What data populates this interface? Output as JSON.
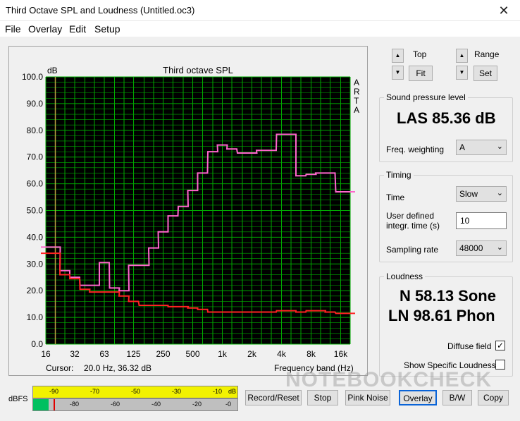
{
  "window": {
    "title": "Third Octave SPL and Loudness (Untitled.oc3)",
    "close_glyph": "✕"
  },
  "menu": {
    "file": "File",
    "overlay": "Overlay",
    "edit": "Edit",
    "setup": "Setup"
  },
  "plot": {
    "unit_label": "dB",
    "xlabel": "Frequency band (Hz)",
    "cursor_label": "Cursor:",
    "cursor_value": "20.0 Hz, 36.32 dB",
    "side_text": [
      "A",
      "R",
      "T",
      "A"
    ]
  },
  "chart_data": {
    "type": "line",
    "title": "Third octave SPL",
    "ylabel": "dB",
    "ylim": [
      0,
      100
    ],
    "y_ticks": [
      "0.0",
      "10.0",
      "20.0",
      "30.0",
      "40.0",
      "50.0",
      "60.0",
      "70.0",
      "80.0",
      "90.0",
      "100.0"
    ],
    "x_scale": "log",
    "x_ticks": [
      "16",
      "32",
      "63",
      "125",
      "250",
      "500",
      "1k",
      "2k",
      "4k",
      "8k",
      "16k"
    ],
    "grid": true,
    "colors": {
      "background": "#000000",
      "grid": "#00aa00",
      "pink": "#ff66cc",
      "red": "#ff2222",
      "cursor": "#b8a040"
    },
    "cursor_x": 20,
    "bands": [
      16,
      20,
      25,
      31.5,
      40,
      50,
      63,
      80,
      100,
      125,
      160,
      200,
      250,
      315,
      400,
      500,
      630,
      800,
      1000,
      1250,
      1600,
      2000,
      2500,
      3150,
      4000,
      5000,
      6300,
      8000,
      10000,
      12500,
      16000,
      20000
    ],
    "series": [
      {
        "values": [
          36.3,
          36.3,
          27.5,
          25,
          22,
          22,
          30.5,
          21,
          20,
          29.5,
          29.5,
          36,
          42,
          48,
          51.5,
          57.5,
          64,
          72,
          74.5,
          73,
          71.5,
          71.5,
          72.5,
          72.5,
          78.5,
          78.5,
          63,
          63.5,
          64,
          64,
          57,
          57
        ]
      },
      {
        "values": [
          34,
          34,
          26,
          24.5,
          20.5,
          19.5,
          19.5,
          19.5,
          18,
          16,
          14.5,
          14.5,
          14.5,
          14,
          14,
          13.5,
          13,
          12,
          12,
          12,
          12,
          12,
          12,
          12,
          12.5,
          12.5,
          12,
          12.5,
          12.5,
          12,
          11.5,
          11.5
        ]
      }
    ]
  },
  "controls": {
    "top_label": "Top",
    "range_label": "Range",
    "fit_label": "Fit",
    "set_label": "Set",
    "up_glyph": "▲",
    "down_glyph": "▼"
  },
  "spl": {
    "group_label": "Sound pressure level",
    "value": "LAS 85.36 dB",
    "freq_weighting_label": "Freq. weighting",
    "freq_weighting_value": "A"
  },
  "timing": {
    "group_label": "Timing",
    "time_label": "Time",
    "time_value": "Slow",
    "user_defined_label_1": "User defined",
    "user_defined_label_2": "integr. time (s)",
    "user_defined_value": "10",
    "sampling_rate_label": "Sampling rate",
    "sampling_rate_value": "48000"
  },
  "loudness": {
    "group_label": "Loudness",
    "sone_value": "N 58.13 Sone",
    "phon_value": "LN 98.61 Phon",
    "diffuse_field_label": "Diffuse field",
    "diffuse_field_checked": "✓",
    "show_specific_label": "Show Specific Loudness"
  },
  "meter": {
    "label": "dBFS",
    "top_ticks": [
      "-90",
      "-70",
      "-50",
      "-30",
      "-10",
      "dB"
    ],
    "bottom_ticks": [
      "-80",
      "-60",
      "-40",
      "-20",
      "-0"
    ]
  },
  "buttons": {
    "record_reset": "Record/Reset",
    "stop": "Stop",
    "pink_noise": "Pink Noise",
    "overlay": "Overlay",
    "bw": "B/W",
    "copy": "Copy"
  },
  "watermark": "NOTEBOOKCHECK"
}
